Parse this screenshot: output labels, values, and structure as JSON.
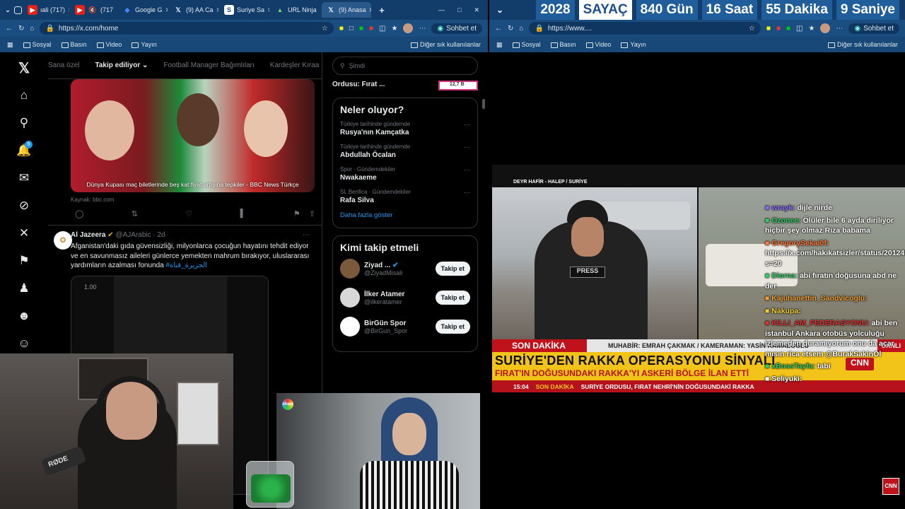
{
  "left_window": {
    "tabs": [
      {
        "title": "ıali (717)",
        "color": "#e62117"
      },
      {
        "title": "(717",
        "color": "#e62117"
      },
      {
        "title": "Google G",
        "color": "#4285f4"
      },
      {
        "title": "(9) AA Ca",
        "color": "#000000"
      },
      {
        "title": "Suriye Sa",
        "color": "#1c4f8c"
      },
      {
        "title": "URL Ninja",
        "color": "#2e7d32"
      },
      {
        "title": "(9) Anasa",
        "color": "#000000"
      }
    ],
    "url": "https://x.com/home",
    "sohbet_label": "Sohbet et",
    "bookmarks": [
      "Sosyal",
      "Basın",
      "Video",
      "Yayın"
    ],
    "bookmarks_other": "Diğer sık kullanılanlar"
  },
  "x": {
    "feed_tabs": [
      "Sana özel",
      "Takip ediliyor",
      "Football Manager Bağımlıları",
      "Kardeşler Kıraa"
    ],
    "tweet1": {
      "image_caption": "Dünya Kupası maç biletlerinde beş kat fiyat artışına tepkiler - BBC News Türkçe",
      "source": "Kaynak: bbc.com"
    },
    "tweet2": {
      "name": "Al Jazeera",
      "handle": "@AJArabic · 2d",
      "text": "Afganistan'daki gıda güvensizliği, milyonlarca çocuğun hayatını tehdit ediyor ve en savunmasız aileleri günlerce yemekten mahrum bırakıyor, uluslararası yardımların azalması fonunda",
      "hashtag": "#الجزيرة_قناة",
      "video_time": "1.00"
    },
    "notification_count": "9",
    "search_placeholder": "Şimdi",
    "promo_snippet": "Ordusu: Fırat ...",
    "promo_badge": "12,7 B",
    "trends_title": "Neler oluyor?",
    "trends": [
      {
        "context": "Türkiye tarihinde gündemde",
        "name": "Rusya'nın Kamçatka"
      },
      {
        "context": "Türkiye tarihinde gündemde",
        "name": "Abdullah Öcalan"
      },
      {
        "context": "Spor · Gündemdekiler",
        "name": "Nwakaeme"
      },
      {
        "context": "SL Benfica · Gündemdekiler",
        "name": "Rafa Silva"
      }
    ],
    "show_more": "Daha fazla göster",
    "who_title": "Kimi takip etmeli",
    "follow_label": "Takip et",
    "who": [
      {
        "name": "Ziyad ...",
        "handle": "@ZiyadMisali",
        "color": "#7a5a3a"
      },
      {
        "name": "İlker Atamer",
        "handle": "@ilkeratamer",
        "color": "#d8d8d8"
      },
      {
        "name": "BirGün Spor",
        "handle": "@BirGun_Spor",
        "color": "#ffffff"
      }
    ]
  },
  "webcam": {
    "mic_text": "RØDE"
  },
  "tv_logo_text": "show",
  "right_window": {
    "counter": [
      "2028",
      "SAYAÇ",
      "840 Gün",
      "16 Saat",
      "55 Dakika",
      "9 Saniye"
    ],
    "url": "https://www....",
    "sohbet_label": "Sohbet et",
    "bookmarks": [
      "Sosyal",
      "Basın",
      "Video",
      "Yayın"
    ],
    "bookmarks_other": "Diğer sık kullanılanlar"
  },
  "news": {
    "location": "DEYR HAFİR - HALEP / SURİYE",
    "son_dakika": "SON DAKİKA",
    "muhabir": "MUHABİR: EMRAH ÇAKMAK / KAMERAMAN: YASİN KAMALOĞLU",
    "canli": "CANLI",
    "headline1": "SURİYE'DEN RAKKA OPERASYONU SİNYALİ",
    "headline2": "FIRAT'IN DOĞUSUNDAKI RAKKA'YI ASKERİ BÖLGE İLAN ETTİ",
    "time": "15:04",
    "ticker_label": "SON DAKİKA",
    "ticker": "SURİYE ORDUSU, FIRAT NEHRİ'NİN DOĞUSUNDAKİ RAKKA",
    "cnn": "CNN",
    "press": "PRESS"
  },
  "chat": [
    {
      "user": "wrayk:",
      "text": "dijle nirde",
      "color": "#8a6bff"
    },
    {
      "user": "Ozonee:",
      "text": "Ölüler bile 6 ayda diriliyor hiçbir şey olmaz Rıza babama",
      "color": "#33cc66"
    },
    {
      "user": "GregorySekai0f:",
      "text": "https://x.com/hakikatsizler/status/2012496027337548061?s=20",
      "color": "#ff7a3a"
    },
    {
      "user": "Diorna:",
      "text": "abi fıratın doğusuna abd ne der",
      "color": "#33cc66"
    },
    {
      "user": "Kajuhanettin_Sandvicoglu:",
      "text": "",
      "color": "#f0a030"
    },
    {
      "user": "Nakupa:",
      "text": "",
      "color": "#f0d030"
    },
    {
      "user": "KILLI_AM_FEDERASYONU:",
      "text": "abi ben istanbul Ankara otobüs yolculuğu izlemeden duramıyorum onu da açar mısın rica etsem @BurakSakinOl",
      "color": "#e03030"
    },
    {
      "user": "xBossTayfa:",
      "text": "tabi",
      "color": "#33cc66"
    },
    {
      "user": "Seliyuki:",
      "text": "",
      "color": "#ffffff"
    }
  ],
  "cnn_corner": "CNN"
}
